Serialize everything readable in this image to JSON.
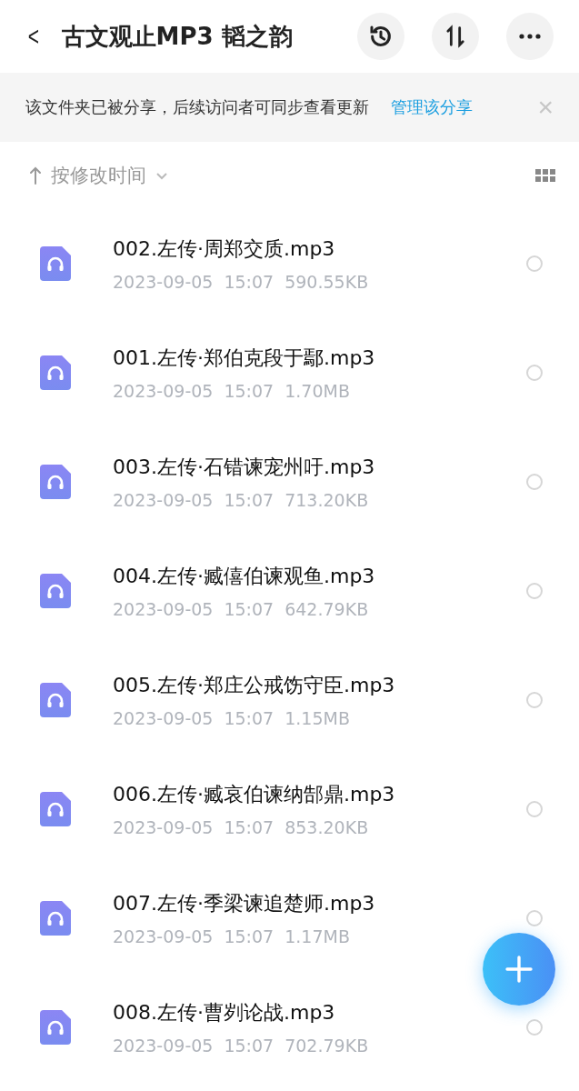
{
  "header": {
    "back": "<",
    "title": "古文观止MP3 韬之韵"
  },
  "share_banner": {
    "message": "该文件夹已被分享，后续访问者可同步查看更新",
    "link": "管理该分享",
    "close": "×"
  },
  "sort": {
    "label": "按修改时间"
  },
  "files": [
    {
      "name": "002.左传·周郑交质.mp3",
      "date": "2023-09-05",
      "time": "15:07",
      "size": "590.55KB",
      "selected": false
    },
    {
      "name": "001.左传·郑伯克段于鄢.mp3",
      "date": "2023-09-05",
      "time": "15:07",
      "size": "1.70MB",
      "selected": false
    },
    {
      "name": "003.左传·石错谏宠州吁.mp3",
      "date": "2023-09-05",
      "time": "15:07",
      "size": "713.20KB",
      "selected": false
    },
    {
      "name": "004.左传·臧僖伯谏观鱼.mp3",
      "date": "2023-09-05",
      "time": "15:07",
      "size": "642.79KB",
      "selected": false
    },
    {
      "name": "005.左传·郑庄公戒饬守臣.mp3",
      "date": "2023-09-05",
      "time": "15:07",
      "size": "1.15MB",
      "selected": false
    },
    {
      "name": "006.左传·臧哀伯谏纳郜鼎.mp3",
      "date": "2023-09-05",
      "time": "15:07",
      "size": "853.20KB",
      "selected": false
    },
    {
      "name": "007.左传·季梁谏追楚师.mp3",
      "date": "2023-09-05",
      "time": "15:07",
      "size": "1.17MB",
      "selected": false
    },
    {
      "name": "008.左传·曹刿论战.mp3",
      "date": "2023-09-05",
      "time": "15:07",
      "size": "702.79KB",
      "selected": false
    }
  ]
}
